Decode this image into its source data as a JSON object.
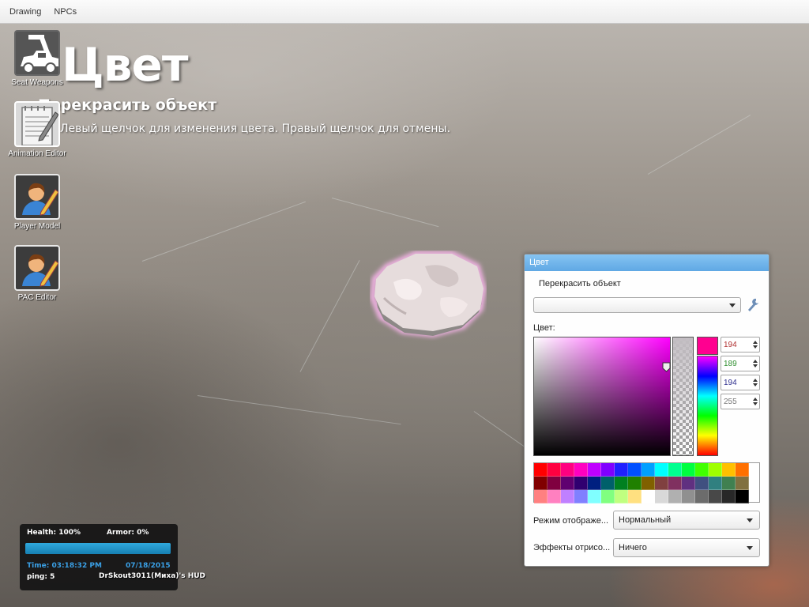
{
  "menubar": {
    "items": [
      "Drawing",
      "NPCs"
    ]
  },
  "tool": {
    "title": "Цвет",
    "subtitle": "Перекрасить объект",
    "hint": "Левый щелчок для изменения цвета. Правый щелчок для отмены."
  },
  "desktop_icons": [
    {
      "label": "Seat Weapons",
      "icon": "jeep-gun-icon"
    },
    {
      "label": "Animation Editor",
      "icon": "notepad-icon"
    },
    {
      "label": "Player Model",
      "icon": "player-edit-icon"
    },
    {
      "label": "PAC Editor",
      "icon": "player-edit-icon"
    }
  ],
  "color_window": {
    "title": "Цвет",
    "subtitle": "Перекрасить объект",
    "preset_value": "",
    "color_label": "Цвет:",
    "rgba": {
      "r": "194",
      "g": "189",
      "b": "194",
      "a": "255"
    },
    "field_colors": {
      "r": "#b03030",
      "g": "#2f8f2f",
      "b": "#30308f",
      "a": "#777777"
    },
    "current_swatch": "#ff0090",
    "render_mode_label": "Режим отображе...",
    "render_mode_value": "Нормальный",
    "render_fx_label": "Эффекты отрисо...",
    "render_fx_value": "Ничего",
    "palette": [
      [
        "#ff0000",
        "#ff0040",
        "#ff0080",
        "#ff00c0",
        "#c000ff",
        "#8000ff",
        "#2020ff",
        "#0050ff",
        "#00a0ff",
        "#00ffff",
        "#00ff90",
        "#00ff40",
        "#40ff00",
        "#a0ff00",
        "#ffc000",
        "#ff7000"
      ],
      [
        "#800000",
        "#800040",
        "#600070",
        "#300070",
        "#002080",
        "#00606a",
        "#008020",
        "#208000",
        "#806000",
        "#804040",
        "#803060",
        "#603080",
        "#405080",
        "#308080",
        "#408050",
        "#807040"
      ],
      [
        "#ff8080",
        "#ff80c0",
        "#c080ff",
        "#8080ff",
        "#80ffff",
        "#80ff80",
        "#c0ff80",
        "#ffe080",
        "#ffffff",
        "#d8d8d8",
        "#b0b0b0",
        "#909090",
        "#6c6c6c",
        "#484848",
        "#282828",
        "#000000"
      ]
    ]
  },
  "hud": {
    "health": "Health: 100%",
    "armor": "Armor: 0%",
    "health_fraction": 1.0,
    "time": "Time: 03:18:32 PM",
    "date": "07/18/2015",
    "ping": "ping: 5",
    "name": "DrSkout3011(Миха)'s HUD"
  }
}
